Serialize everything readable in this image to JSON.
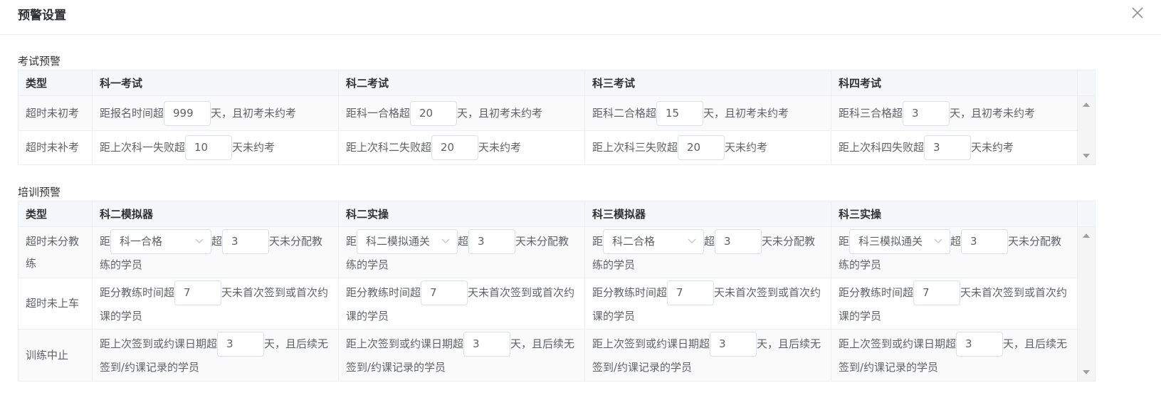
{
  "dialog": {
    "title": "预警设置"
  },
  "exam_section": {
    "title": "考试预警",
    "headers": [
      "类型",
      "科一考试",
      "科二考试",
      "科三考试",
      "科四考试"
    ],
    "rows": [
      {
        "type": "超时未初考",
        "cells": [
          {
            "prefix": "距报名时间超",
            "value": "999",
            "suffix": "天，且初考未约考"
          },
          {
            "prefix": "距科一合格超",
            "value": "20",
            "suffix": "天，且初考未约考"
          },
          {
            "prefix": "距科二合格超",
            "value": "15",
            "suffix": "天，且初考未约考"
          },
          {
            "prefix": "距科三合格超",
            "value": "3",
            "suffix": "天，且初考未约考"
          }
        ]
      },
      {
        "type": "超时未补考",
        "cells": [
          {
            "prefix": "距上次科一失败超",
            "value": "10",
            "suffix": "天未约考"
          },
          {
            "prefix": "距上次科二失败超",
            "value": "20",
            "suffix": "天未约考"
          },
          {
            "prefix": "距上次科三失败超",
            "value": "20",
            "suffix": "天未约考"
          },
          {
            "prefix": "距上次科四失败超",
            "value": "3",
            "suffix": "天未约考"
          }
        ]
      }
    ]
  },
  "training_section": {
    "title": "培训预警",
    "headers": [
      "类型",
      "科二模拟器",
      "科二实操",
      "科三模拟器",
      "科三实操"
    ],
    "rows": [
      {
        "type": "超时未分教练",
        "kind": "select",
        "cells": [
          {
            "prefix": "距",
            "select": "科一合格",
            "mid": "超",
            "value": "3",
            "suffix": "天未分配教练的学员"
          },
          {
            "prefix": "距",
            "select": "科二模拟通关",
            "mid": "超",
            "value": "3",
            "suffix": "天未分配教练的学员"
          },
          {
            "prefix": "距",
            "select": "科二合格",
            "mid": "超",
            "value": "3",
            "suffix": "天未分配教练的学员"
          },
          {
            "prefix": "距",
            "select": "科三模拟通关",
            "mid": "超",
            "value": "3",
            "suffix": "天未分配教练的学员"
          }
        ]
      },
      {
        "type": "超时未上车",
        "cells": [
          {
            "prefix": "距分教练时间超",
            "value": "7",
            "suffix": "天未首次签到或首次约课的学员"
          },
          {
            "prefix": "距分教练时间超",
            "value": "7",
            "suffix": "天未首次签到或首次约课的学员"
          },
          {
            "prefix": "距分教练时间超",
            "value": "7",
            "suffix": "天未首次签到或首次约课的学员"
          },
          {
            "prefix": "距分教练时间超",
            "value": "7",
            "suffix": "天未首次签到或首次约课的学员"
          }
        ]
      },
      {
        "type": "训练中止",
        "cells": [
          {
            "prefix": "距上次签到或约课日期超",
            "value": "3",
            "suffix": "天，且后续无签到/约课记录的学员"
          },
          {
            "prefix": "距上次签到或约课日期超",
            "value": "3",
            "suffix": "天，且后续无签到/约课记录的学员"
          },
          {
            "prefix": "距上次签到或约课日期超",
            "value": "3",
            "suffix": "天，且后续无签到/约课记录的学员"
          },
          {
            "prefix": "距上次签到或约课日期超",
            "value": "3",
            "suffix": "天，且后续无签到/约课记录的学员"
          }
        ]
      }
    ]
  },
  "icons": {
    "close": "close-icon",
    "select_arrow": "chevron-down-icon",
    "scroll_up": "scroll-up-arrow-icon",
    "scroll_down": "scroll-down-arrow-icon"
  }
}
